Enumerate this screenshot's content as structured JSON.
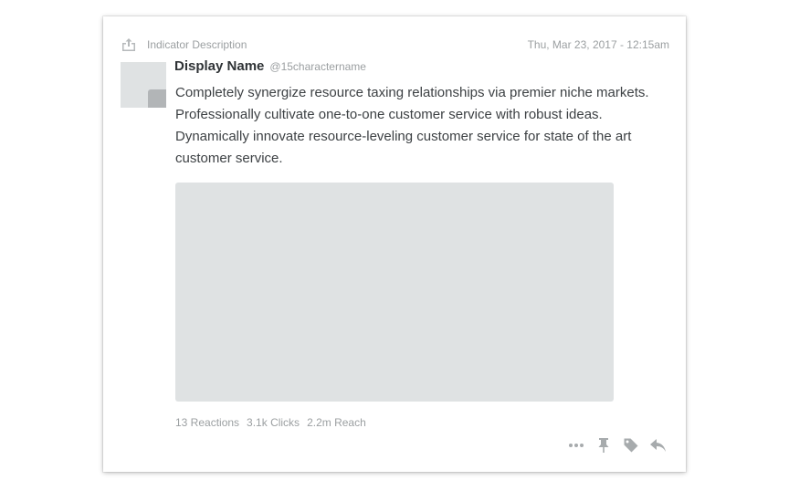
{
  "post": {
    "indicator_icon": "share-upload-icon",
    "indicator_label": "Indicator Description",
    "timestamp": "Thu, Mar 23, 2017 - 12:15am",
    "author": {
      "display_name": "Display Name",
      "handle": "@15charactername"
    },
    "body": "Completely synergize resource taxing relationships via premier niche markets. Professionally cultivate one-to-one customer service with robust ideas. Dynamically innovate resource-leveling customer service for state of the art customer service.",
    "stats": {
      "reactions": "13 Reactions",
      "clicks": "3.1k Clicks",
      "reach": "2.2m Reach"
    },
    "actions": [
      "more-icon",
      "pin-icon",
      "tag-icon",
      "reply-icon"
    ]
  },
  "colors": {
    "muted_text": "#9b9fa1",
    "primary_text": "#3d4144",
    "placeholder": "#dfe2e3",
    "icon": "#a7abad"
  }
}
